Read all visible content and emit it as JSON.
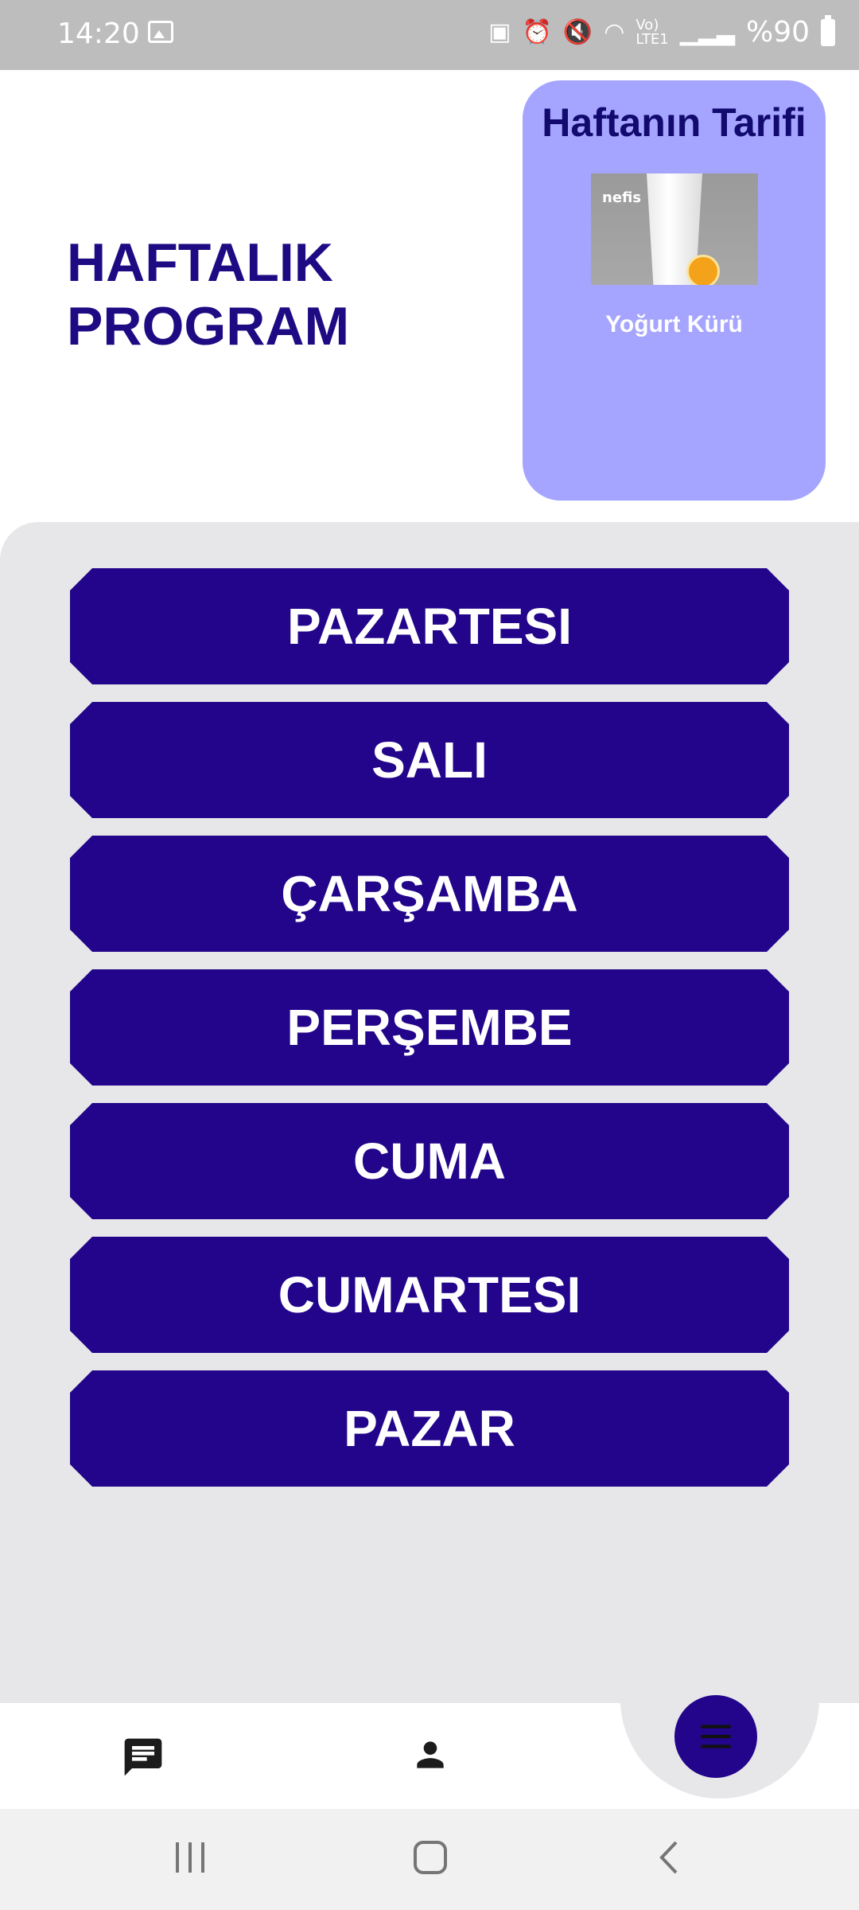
{
  "status_bar": {
    "time": "14:20",
    "battery": "%90",
    "icons": [
      "image-icon",
      "battery-saver-icon",
      "alarm-icon",
      "mute-icon",
      "wifi-icon",
      "volte-lte-icon",
      "signal-icon",
      "battery-icon"
    ]
  },
  "header": {
    "title_line1": "HAFTALIK",
    "title_line2": "PROGRAM"
  },
  "recipe_card": {
    "title": "Haftanın Tarifi",
    "image_brand": "nefis",
    "recipe_name": "Yoğurt Kürü"
  },
  "days": [
    {
      "label": "PAZARTESI"
    },
    {
      "label": "SALI"
    },
    {
      "label": "ÇARŞAMBA"
    },
    {
      "label": "PERŞEMBE"
    },
    {
      "label": "CUMA"
    },
    {
      "label": "CUMARTESI"
    },
    {
      "label": "PAZAR"
    }
  ],
  "bottom_nav": {
    "items": [
      "chat-icon",
      "person-icon",
      "menu-icon"
    ]
  },
  "colors": {
    "primary": "#22058a",
    "title": "#1e0a83",
    "card_bg": "#a5a5ff",
    "panel_bg": "#e7e7ea"
  }
}
